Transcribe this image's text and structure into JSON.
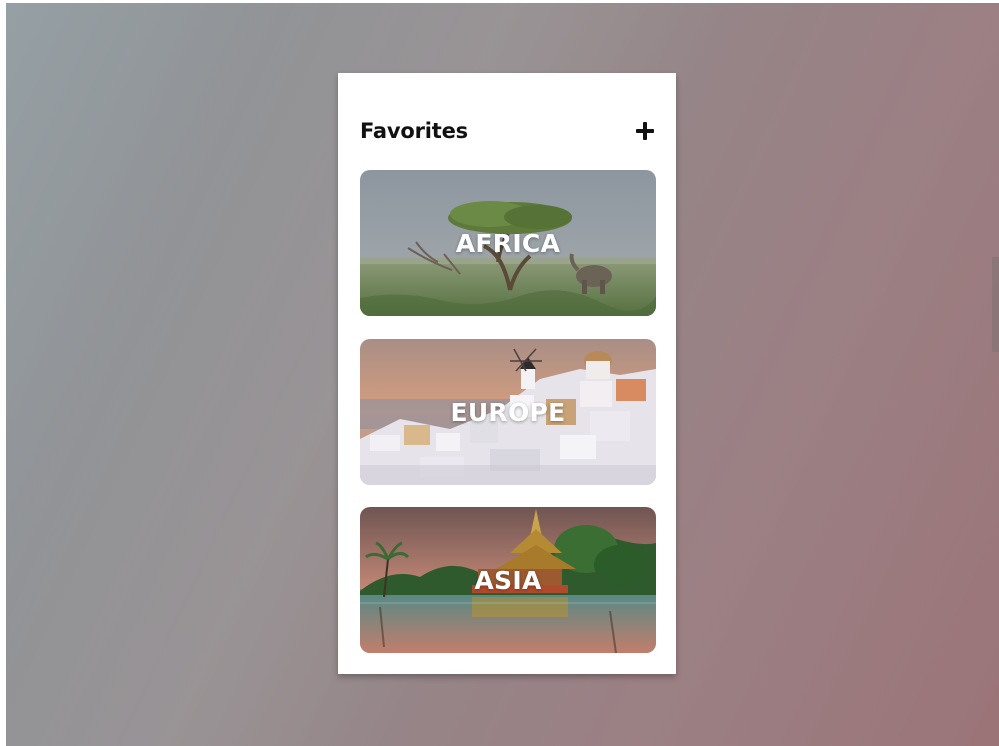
{
  "favorites": {
    "title": "Favorites",
    "add_icon": "plus-icon",
    "cards": [
      {
        "label": "AFRICA"
      },
      {
        "label": "EUROPE"
      },
      {
        "label": "ASIA"
      }
    ]
  }
}
